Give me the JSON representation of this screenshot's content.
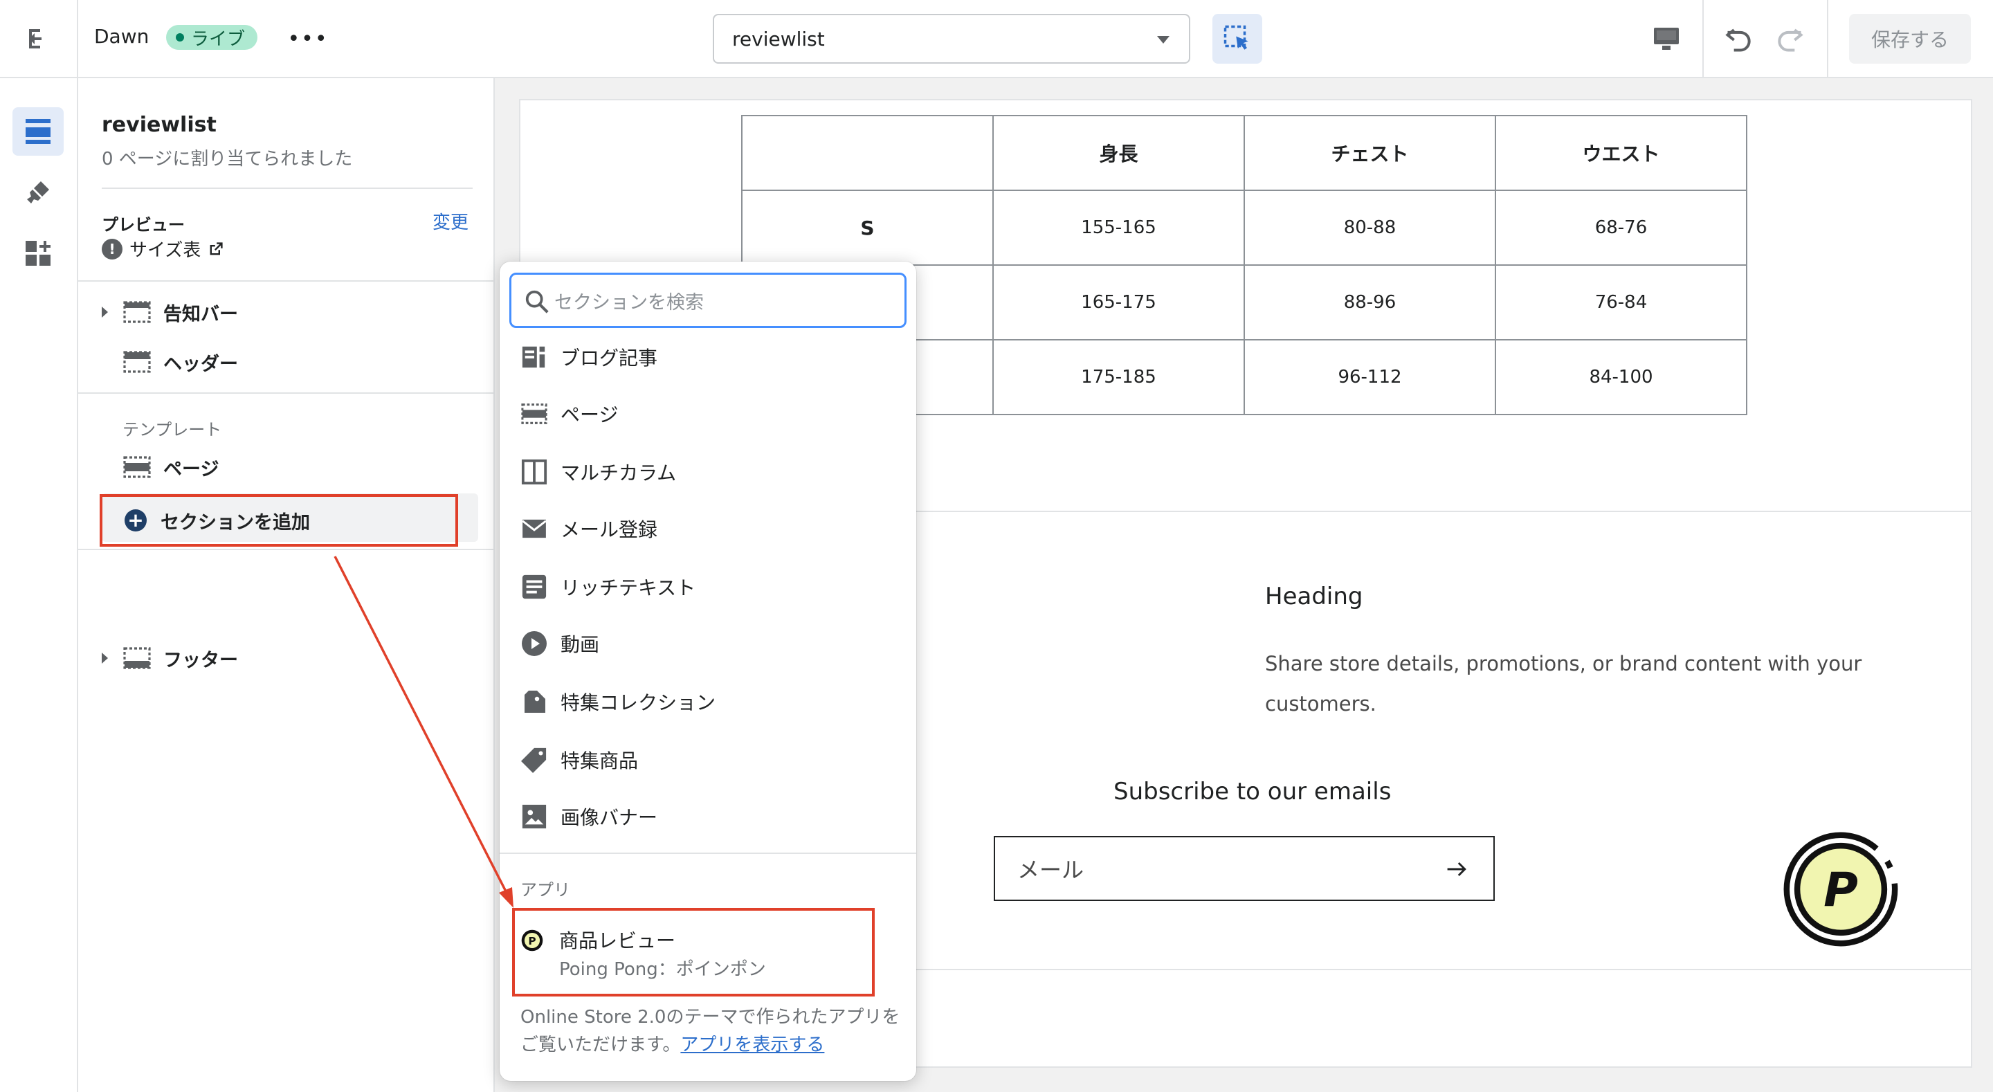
{
  "topbar": {
    "theme_name": "Dawn",
    "live_badge": "ライブ",
    "more_label": "•••",
    "page_select_value": "reviewlist",
    "save_label": "保存する"
  },
  "sidebar": {
    "template_title": "reviewlist",
    "template_subtitle": "0 ページに割り当てられました",
    "preview_label": "プレビュー",
    "change_link": "変更",
    "preview_value": "サイズ表",
    "sections": {
      "announcement_bar": "告知バー",
      "header": "ヘッダー",
      "template_group": "テンプレート",
      "page": "ページ",
      "add_section": "セクションを追加",
      "footer": "フッター"
    }
  },
  "preview": {
    "size_table": {
      "headers": [
        "",
        "身長",
        "チェスト",
        "ウエスト"
      ],
      "rows": [
        [
          "S",
          "155-165",
          "80-88",
          "68-76"
        ],
        [
          "",
          "165-175",
          "88-96",
          "76-84"
        ],
        [
          "",
          "175-185",
          "96-112",
          "84-100"
        ]
      ]
    },
    "heading": "Heading",
    "richtext": "Share store details, promotions, or brand content with your customers.",
    "subscribe_title": "Subscribe to our emails",
    "email_placeholder": "メール"
  },
  "popover": {
    "search_placeholder": "セクションを検索",
    "items": [
      {
        "label": "ブログ記事",
        "icon": "blog-icon"
      },
      {
        "label": "ページ",
        "icon": "page-icon"
      },
      {
        "label": "マルチカラム",
        "icon": "multicolumn-icon"
      },
      {
        "label": "メール登録",
        "icon": "email-icon"
      },
      {
        "label": "リッチテキスト",
        "icon": "richtext-icon"
      },
      {
        "label": "動画",
        "icon": "video-icon"
      },
      {
        "label": "特集コレクション",
        "icon": "collection-icon"
      },
      {
        "label": "特集商品",
        "icon": "tag-icon"
      },
      {
        "label": "画像バナー",
        "icon": "image-icon"
      }
    ],
    "apps_label": "アプリ",
    "app": {
      "name": "商品レビュー",
      "vendor": "Poing Pong：ポインポン"
    },
    "footnote_text": "Online Store 2.0のテーマで作られたアプリをご覧いただけます。",
    "footnote_link": "アプリを表示する"
  },
  "colors": {
    "accent": "#2c6ecb",
    "highlight": "#e0402a",
    "live_badge_bg": "#aee9d1",
    "poing_yellow": "#f1f5b0"
  }
}
